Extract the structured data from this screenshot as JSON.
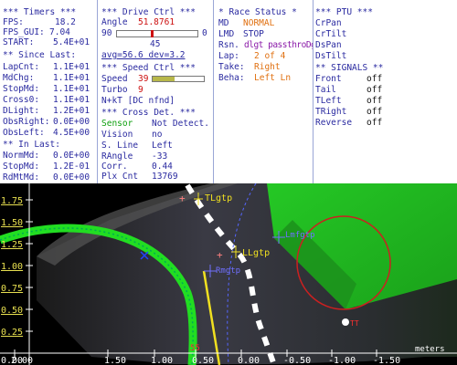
{
  "timers": {
    "header": "*** Timers ***",
    "rows": [
      {
        "label": "FPS:",
        "value": "18.2"
      },
      {
        "label": "FPS_GUI:",
        "value": "7.04"
      },
      {
        "label": "START:",
        "value": "5.4E+01"
      }
    ],
    "since_header": "** Since Last:",
    "since_rows": [
      {
        "label": "LapCnt:",
        "value": "1.1E+01"
      },
      {
        "label": "MdChg:",
        "value": "1.1E+01"
      },
      {
        "label": "StopMd:",
        "value": "1.1E+01"
      },
      {
        "label": "Cross0:",
        "value": "1.1E+01"
      },
      {
        "label": "DLight:",
        "value": "1.2E+01"
      },
      {
        "label": "ObsRight:",
        "value": "0.0E+00"
      },
      {
        "label": "ObsLeft:",
        "value": "4.5E+00"
      }
    ],
    "in_header": "** In Last:",
    "in_rows": [
      {
        "label": "NormMd:",
        "value": "0.0E+00"
      },
      {
        "label": "StopMd:",
        "value": "1.2E-01"
      },
      {
        "label": "RdMtMd:",
        "value": "0.0E+00"
      }
    ]
  },
  "drive": {
    "header": "*** Drive Ctrl ***",
    "angle_label": "Angle",
    "angle_value": "51.8761",
    "slider_min": "90",
    "slider_max": "0",
    "slider_level": 0.43,
    "slider_center": "45",
    "avg_text": "avg=56.6 dev=3.2",
    "speed_header": "*** Speed Ctrl ***",
    "speed_label": "Speed",
    "speed_value": "39",
    "speed_level": 0.42,
    "turbo_label": "Turbo",
    "turbo_value": "9",
    "nxkt": "N+kT [DC nfnd]",
    "cross_header": "*** Cross Det. ***",
    "cross_rows": [
      {
        "label": "Sensor",
        "value": "Not Detect."
      },
      {
        "label": "Vision",
        "value": "no"
      },
      {
        "label": "S. Line",
        "value": "Left"
      },
      {
        "label": "RAngle",
        "value": "-33"
      },
      {
        "label": "Corr.",
        "value": "0.44"
      },
      {
        "label": "Plx Cnt",
        "value": "13769"
      }
    ]
  },
  "race": {
    "header": "* Race Status *",
    "rows": [
      {
        "label": "MD",
        "value": "NORMAL"
      },
      {
        "label": "LMD",
        "value": "STOP"
      },
      {
        "label": "Rsn.",
        "value": "dlgt passthroDgMan"
      },
      {
        "label": "Lap:",
        "value": "2 of 4"
      },
      {
        "label": "Take:",
        "value": "Right"
      },
      {
        "label": "Beha:",
        "value": "Left Ln"
      }
    ]
  },
  "ptu": {
    "header": "*** PTU ***",
    "items": [
      "CrPan",
      "CrTilt",
      "DsPan",
      "DsTilt"
    ],
    "signals_header": "** SIGNALS **",
    "signals": [
      {
        "label": "Front",
        "value": "off"
      },
      {
        "label": "Tail",
        "value": "off"
      },
      {
        "label": "TLeft",
        "value": "off"
      },
      {
        "label": "TRight",
        "value": "off"
      },
      {
        "label": "Reverse",
        "value": "off"
      }
    ]
  },
  "camera": {
    "y_ticks": [
      "1.75",
      "1.50",
      "1.25",
      "1.00",
      "0.75",
      "0.50",
      "0.25"
    ],
    "x_ticks": [
      "2.00",
      "1.50",
      "1.00",
      "0.50",
      "0.00",
      "-0.50",
      "-1.00",
      "-1.50"
    ],
    "x_tick_prefix": "0.00",
    "units_label": "meters",
    "labels": [
      "TLgtp",
      "LLgtp",
      "Lmfgtp",
      "Rmgtp",
      "TT",
      "55"
    ],
    "colors": {
      "track_green": "#22dd22",
      "box_green": "#2bd82b",
      "circle": "#cc2020",
      "axis": "#ffffff",
      "ytick": "#e8e050",
      "label": "#7070ff"
    }
  }
}
